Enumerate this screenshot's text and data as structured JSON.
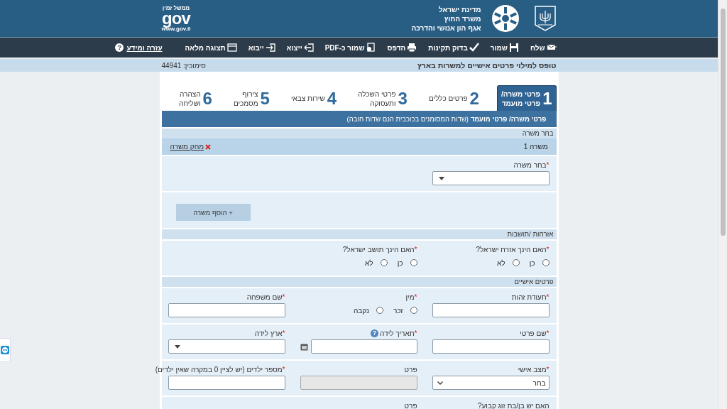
{
  "header": {
    "org_lines": [
      "מדינת ישראל",
      "משרד החוץ",
      "אגף הון אנושי והדרכה"
    ],
    "logo": {
      "top": "ממשל זמין",
      "word": "gov",
      "url": "www.gov.il"
    }
  },
  "toolbar": [
    {
      "label": "שלח",
      "kind": "send"
    },
    {
      "label": "שמור",
      "kind": "save"
    },
    {
      "label": "בדוק תקינות",
      "kind": "check"
    },
    {
      "label": "הדפס",
      "kind": "print"
    },
    {
      "label": "שמור כ-PDF",
      "kind": "pdf"
    },
    {
      "label": "ייצוא",
      "kind": "export"
    },
    {
      "label": "ייבוא",
      "kind": "import"
    },
    {
      "label": "תצוגה מלאה",
      "kind": "fullscreen"
    }
  ],
  "help": {
    "label": "עזרה ומידע",
    "glyph": "?"
  },
  "title": "טופס למילוי פרטים אישיים למשרות בארץ",
  "reference": "סימוכין: 44941",
  "steps": [
    {
      "number": "1",
      "label": "פרטי משרה/\nפרטי מועמד",
      "selected": true
    },
    {
      "number": "2",
      "label": "פרטים כללים",
      "selected": false
    },
    {
      "number": "3",
      "label": "פרטי השכלה\nותעסוקה",
      "selected": false
    },
    {
      "number": "4",
      "label": "שירות צבאי",
      "selected": false
    },
    {
      "number": "5",
      "label": "צירוף\nמסמכים",
      "selected": false
    },
    {
      "number": "6",
      "label": "הצהרה\nושליחה",
      "selected": false
    }
  ],
  "section": {
    "heading": "**פרטי משרה/ פרטי מועמד** (שדות המסומנים בכוכבית הנם שדות חובה)"
  },
  "blocks": [
    {
      "kind": "subheader",
      "text": "בחר משרה"
    },
    {
      "kind": "job_row",
      "title": "משרה 1",
      "action": "מחק משרה"
    },
    {
      "kind": "panel",
      "rows": [
        [
          {
            "kind": "select",
            "mark": "*",
            "label": "בחר משרה"
          }
        ]
      ]
    },
    {
      "kind": "button_panel",
      "button": "+ הוסף משרה"
    },
    {
      "kind": "subheader",
      "text": "אזרחות /תושבות"
    },
    {
      "kind": "panel",
      "rows": [
        [
          {
            "kind": "radio",
            "mark": "*",
            "label": "האם הינך אזרח ישראל?",
            "options": [
              {
                "label": "כן",
                "checked": false
              },
              {
                "label": "לא",
                "checked": false
              }
            ]
          },
          {
            "kind": "radio",
            "mark": "*",
            "label": "האם הינך תושב ישראל?",
            "options": [
              {
                "label": "כן",
                "checked": false
              },
              {
                "label": "לא",
                "checked": false
              }
            ]
          }
        ]
      ]
    },
    {
      "kind": "subheader",
      "text": "פרטים אישיים"
    },
    {
      "kind": "panel",
      "rows": [
        [
          {
            "kind": "text",
            "mark": "*",
            "label": "תעודת זהות",
            "disabled": false
          },
          {
            "kind": "radio",
            "mark": "*",
            "label": "מין",
            "options": [
              {
                "label": "זכר",
                "checked": false
              },
              {
                "label": "נקבה",
                "checked": false
              }
            ]
          },
          {
            "kind": "text",
            "mark": "*",
            "label": "שם משפחה",
            "disabled": false
          }
        ],
        [
          {
            "kind": "text",
            "mark": "*",
            "label": "שם פרטי",
            "disabled": false
          },
          {
            "kind": "date",
            "mark": "*",
            "label": "תאריך לידה",
            "help": "?"
          },
          {
            "kind": "select",
            "mark": "*",
            "label": "ארץ לידה"
          }
        ],
        [
          {
            "kind": "native_select",
            "mark": "*",
            "label": "מצב אישי",
            "value": "בחר"
          },
          {
            "kind": "text",
            "label": "פרט",
            "disabled": true
          },
          {
            "kind": "text",
            "mark": "*",
            "label": "מספר ילדים (יש לציין 0 במקרה שאין ילדים)",
            "disabled": false
          }
        ],
        [
          {
            "kind": "cut",
            "label": "האם יש בן/בת זוג קבוע?"
          },
          {
            "kind": "cut",
            "label": "פרט"
          }
        ]
      ]
    }
  ]
}
